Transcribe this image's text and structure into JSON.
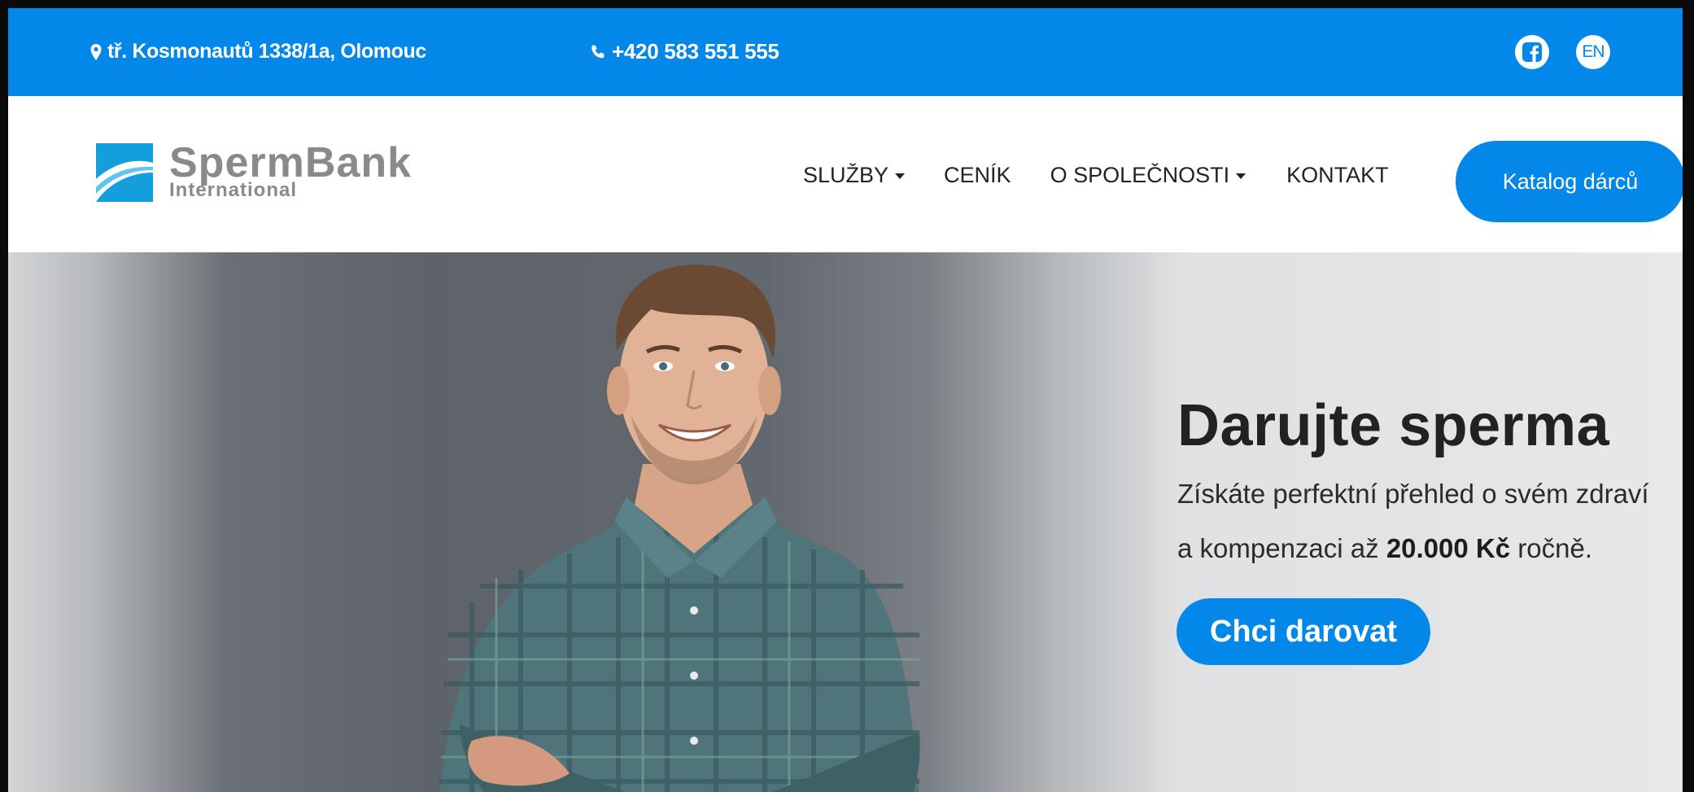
{
  "topbar": {
    "address": "tř. Kosmonautů 1338/1a, Olomouc",
    "phone": "+420 583 551 555",
    "lang": "EN",
    "bg_color": "#0388ea"
  },
  "logo": {
    "name": "SpermBank",
    "sub": "International"
  },
  "nav": {
    "items": [
      {
        "label": "SLUŽBY",
        "dropdown": true
      },
      {
        "label": "CENÍK",
        "dropdown": false
      },
      {
        "label": "O SPOLEČNOSTI",
        "dropdown": true
      },
      {
        "label": "KONTAKT",
        "dropdown": false
      }
    ],
    "cta_label": "Katalog dárců"
  },
  "hero": {
    "title": "Darujte sperma",
    "line1": "Získáte perfektní přehled o svém zdraví",
    "line2_pre": "a kompenzaci až ",
    "line2_bold": "20.000 Kč",
    "line2_post": " ročně.",
    "cta_label": "Chci darovat"
  },
  "icons": {
    "address": "map-pin-icon",
    "phone": "phone-icon",
    "social": "facebook-icon"
  }
}
